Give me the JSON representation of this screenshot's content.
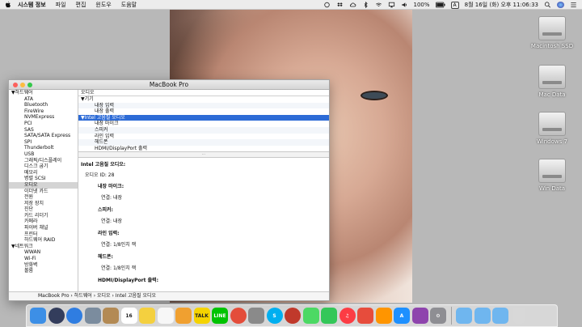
{
  "menubar": {
    "app_name": "시스템 정보",
    "items": [
      "파일",
      "편집",
      "윈도우",
      "도움말"
    ],
    "battery": "100%",
    "input_source": "A",
    "datetime": "8월 16일 (화) 오후 11:06:33"
  },
  "desktop": {
    "icons": [
      "Macintosh SSD",
      "Mac Data",
      "Windows 7",
      "Win Data"
    ]
  },
  "window": {
    "title": "MacBook Pro",
    "sidebar": {
      "hardware_header": "▼하드웨어",
      "hardware_items": [
        "ATA",
        "Bluetooth",
        "FireWire",
        "NVMExpress",
        "PCI",
        "SAS",
        "SATA/SATA Express",
        "SPI",
        "Thunderbolt",
        "USB",
        "그래픽/디스플레이",
        "디스크 굽기",
        "메모리",
        "병렬 SCSI",
        "오디오",
        "이더넷 카드",
        "전원",
        "저장 장치",
        "진단",
        "카드 리더기",
        "카메라",
        "파이버 채널",
        "프린터",
        "하드웨어 RAID"
      ],
      "selected": "오디오",
      "network_header": "▼네트워크",
      "network_items": [
        "WWAN",
        "Wi-Fi",
        "방화벽",
        "볼륨"
      ]
    },
    "tree": {
      "header": "오디오",
      "rows": [
        {
          "label": "▼기기",
          "level": 0
        },
        {
          "label": "내장 입력",
          "level": 1
        },
        {
          "label": "내장 출력",
          "level": 1
        },
        {
          "label": "▼Intel 고음질 오디오",
          "level": 0,
          "selected": true
        },
        {
          "label": "내장 마이크",
          "level": 1
        },
        {
          "label": "스피커",
          "level": 1
        },
        {
          "label": "라인 입력",
          "level": 1
        },
        {
          "label": "헤드폰",
          "level": 1
        },
        {
          "label": "HDMI/DisplayPort 출력",
          "level": 1
        }
      ]
    },
    "detail": {
      "title": "Intel 고음질 오디오:",
      "audio_id": "오디오 ID:   28",
      "sections": [
        {
          "heading": "내장 마이크:",
          "value": "연결:   내장"
        },
        {
          "heading": "스피커:",
          "value": "연결:   내장"
        },
        {
          "heading": "라인 입력:",
          "value": "연결:   1/8인치 잭"
        },
        {
          "heading": "헤드폰:",
          "value": "연결:   1/8인치 잭"
        },
        {
          "heading": "HDMI/DisplayPort 출력:",
          "value": ""
        }
      ]
    },
    "pathbar": "MacBook Pro  ›  하드웨어  ›  오디오  ›  Intel 고음질 오디오"
  },
  "dock": {
    "apps": [
      {
        "name": "finder",
        "color": "#3d8fe6",
        "text": ""
      },
      {
        "name": "siri",
        "color": "#333d5c",
        "text": ""
      },
      {
        "name": "safari",
        "color": "#2f7de1",
        "text": ""
      },
      {
        "name": "photo-app",
        "color": "#7b8c9e",
        "text": ""
      },
      {
        "name": "contacts",
        "color": "#b38a54",
        "text": ""
      },
      {
        "name": "calendar",
        "color": "#ffffff",
        "text": "16"
      },
      {
        "name": "notes",
        "color": "#f4d03f",
        "text": ""
      },
      {
        "name": "reminders",
        "color": "#f7f7f7",
        "text": ""
      },
      {
        "name": "photos",
        "color": "#f0a030",
        "text": ""
      },
      {
        "name": "talk",
        "color": "#f5d300",
        "text": "TALK"
      },
      {
        "name": "line",
        "color": "#00c300",
        "text": "LINE"
      },
      {
        "name": "chrome",
        "color": "#e44d3a",
        "text": ""
      },
      {
        "name": "app-gray",
        "color": "#8a8a8a",
        "text": ""
      },
      {
        "name": "skype",
        "color": "#00aff0",
        "text": "S"
      },
      {
        "name": "app-red",
        "color": "#c0392b",
        "text": ""
      },
      {
        "name": "messages",
        "color": "#4cd964",
        "text": ""
      },
      {
        "name": "facetime",
        "color": "#34c759",
        "text": ""
      },
      {
        "name": "music",
        "color": "#fc3c44",
        "text": "♫"
      },
      {
        "name": "app-red-2",
        "color": "#e74c3c",
        "text": ""
      },
      {
        "name": "books",
        "color": "#ff9500",
        "text": ""
      },
      {
        "name": "app-store",
        "color": "#1e90ff",
        "text": "A"
      },
      {
        "name": "launch-app",
        "color": "#8e44ad",
        "text": ""
      },
      {
        "name": "settings",
        "color": "#8e8e93",
        "text": "⚙"
      }
    ],
    "folders": [
      {
        "name": "folder-1",
        "color": "#6fb6ef"
      },
      {
        "name": "folder-2",
        "color": "#6fb6ef"
      },
      {
        "name": "folder-3",
        "color": "#6fb6ef"
      },
      {
        "name": "trash",
        "color": "#d8d8d8"
      }
    ]
  }
}
